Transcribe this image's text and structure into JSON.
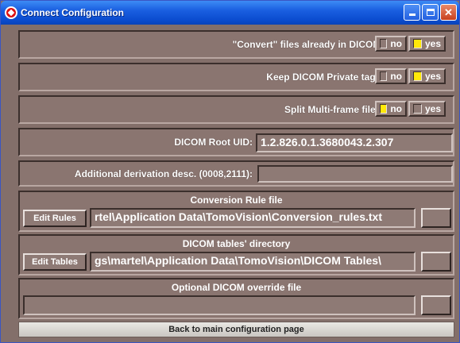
{
  "window": {
    "title": "Connect Configuration"
  },
  "convert": {
    "label": "\"Convert\" files already in DICOM ?",
    "no_label": "no",
    "yes_label": "yes",
    "selected": "yes"
  },
  "private_tags": {
    "label": "Keep DICOM Private tags ?",
    "no_label": "no",
    "yes_label": "yes",
    "selected": "yes"
  },
  "multiframe": {
    "label": "Split Multi-frame files ?",
    "no_label": "no",
    "yes_label": "yes",
    "selected": "no"
  },
  "root_uid": {
    "label": "DICOM Root UID:",
    "value": "1.2.826.0.1.3680043.2.307"
  },
  "derivation": {
    "label": "Additional derivation desc. (0008,2111):",
    "value": ""
  },
  "conversion_rule": {
    "header": "Conversion Rule file",
    "button_label": "Edit Rules",
    "value": "rtel\\Application Data\\TomoVision\\Conversion_rules.txt"
  },
  "dicom_tables": {
    "header": "DICOM tables' directory",
    "button_label": "Edit Tables",
    "value": "gs\\martel\\Application Data\\TomoVision\\DICOM Tables\\"
  },
  "override": {
    "header": "Optional DICOM override file",
    "value": ""
  },
  "back": {
    "label": "Back to main configuration page"
  }
}
